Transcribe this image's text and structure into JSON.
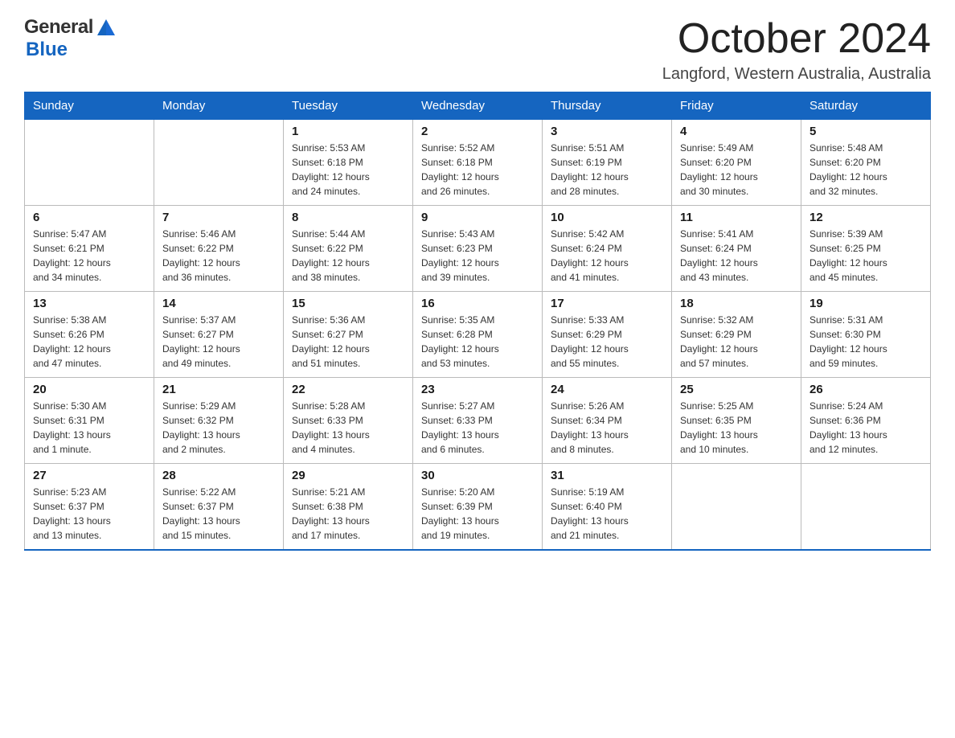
{
  "header": {
    "title": "October 2024",
    "subtitle": "Langford, Western Australia, Australia",
    "logo_general": "General",
    "logo_blue": "Blue"
  },
  "days_of_week": [
    "Sunday",
    "Monday",
    "Tuesday",
    "Wednesday",
    "Thursday",
    "Friday",
    "Saturday"
  ],
  "weeks": [
    [
      {
        "date": "",
        "info": ""
      },
      {
        "date": "",
        "info": ""
      },
      {
        "date": "1",
        "info": "Sunrise: 5:53 AM\nSunset: 6:18 PM\nDaylight: 12 hours\nand 24 minutes."
      },
      {
        "date": "2",
        "info": "Sunrise: 5:52 AM\nSunset: 6:18 PM\nDaylight: 12 hours\nand 26 minutes."
      },
      {
        "date": "3",
        "info": "Sunrise: 5:51 AM\nSunset: 6:19 PM\nDaylight: 12 hours\nand 28 minutes."
      },
      {
        "date": "4",
        "info": "Sunrise: 5:49 AM\nSunset: 6:20 PM\nDaylight: 12 hours\nand 30 minutes."
      },
      {
        "date": "5",
        "info": "Sunrise: 5:48 AM\nSunset: 6:20 PM\nDaylight: 12 hours\nand 32 minutes."
      }
    ],
    [
      {
        "date": "6",
        "info": "Sunrise: 5:47 AM\nSunset: 6:21 PM\nDaylight: 12 hours\nand 34 minutes."
      },
      {
        "date": "7",
        "info": "Sunrise: 5:46 AM\nSunset: 6:22 PM\nDaylight: 12 hours\nand 36 minutes."
      },
      {
        "date": "8",
        "info": "Sunrise: 5:44 AM\nSunset: 6:22 PM\nDaylight: 12 hours\nand 38 minutes."
      },
      {
        "date": "9",
        "info": "Sunrise: 5:43 AM\nSunset: 6:23 PM\nDaylight: 12 hours\nand 39 minutes."
      },
      {
        "date": "10",
        "info": "Sunrise: 5:42 AM\nSunset: 6:24 PM\nDaylight: 12 hours\nand 41 minutes."
      },
      {
        "date": "11",
        "info": "Sunrise: 5:41 AM\nSunset: 6:24 PM\nDaylight: 12 hours\nand 43 minutes."
      },
      {
        "date": "12",
        "info": "Sunrise: 5:39 AM\nSunset: 6:25 PM\nDaylight: 12 hours\nand 45 minutes."
      }
    ],
    [
      {
        "date": "13",
        "info": "Sunrise: 5:38 AM\nSunset: 6:26 PM\nDaylight: 12 hours\nand 47 minutes."
      },
      {
        "date": "14",
        "info": "Sunrise: 5:37 AM\nSunset: 6:27 PM\nDaylight: 12 hours\nand 49 minutes."
      },
      {
        "date": "15",
        "info": "Sunrise: 5:36 AM\nSunset: 6:27 PM\nDaylight: 12 hours\nand 51 minutes."
      },
      {
        "date": "16",
        "info": "Sunrise: 5:35 AM\nSunset: 6:28 PM\nDaylight: 12 hours\nand 53 minutes."
      },
      {
        "date": "17",
        "info": "Sunrise: 5:33 AM\nSunset: 6:29 PM\nDaylight: 12 hours\nand 55 minutes."
      },
      {
        "date": "18",
        "info": "Sunrise: 5:32 AM\nSunset: 6:29 PM\nDaylight: 12 hours\nand 57 minutes."
      },
      {
        "date": "19",
        "info": "Sunrise: 5:31 AM\nSunset: 6:30 PM\nDaylight: 12 hours\nand 59 minutes."
      }
    ],
    [
      {
        "date": "20",
        "info": "Sunrise: 5:30 AM\nSunset: 6:31 PM\nDaylight: 13 hours\nand 1 minute."
      },
      {
        "date": "21",
        "info": "Sunrise: 5:29 AM\nSunset: 6:32 PM\nDaylight: 13 hours\nand 2 minutes."
      },
      {
        "date": "22",
        "info": "Sunrise: 5:28 AM\nSunset: 6:33 PM\nDaylight: 13 hours\nand 4 minutes."
      },
      {
        "date": "23",
        "info": "Sunrise: 5:27 AM\nSunset: 6:33 PM\nDaylight: 13 hours\nand 6 minutes."
      },
      {
        "date": "24",
        "info": "Sunrise: 5:26 AM\nSunset: 6:34 PM\nDaylight: 13 hours\nand 8 minutes."
      },
      {
        "date": "25",
        "info": "Sunrise: 5:25 AM\nSunset: 6:35 PM\nDaylight: 13 hours\nand 10 minutes."
      },
      {
        "date": "26",
        "info": "Sunrise: 5:24 AM\nSunset: 6:36 PM\nDaylight: 13 hours\nand 12 minutes."
      }
    ],
    [
      {
        "date": "27",
        "info": "Sunrise: 5:23 AM\nSunset: 6:37 PM\nDaylight: 13 hours\nand 13 minutes."
      },
      {
        "date": "28",
        "info": "Sunrise: 5:22 AM\nSunset: 6:37 PM\nDaylight: 13 hours\nand 15 minutes."
      },
      {
        "date": "29",
        "info": "Sunrise: 5:21 AM\nSunset: 6:38 PM\nDaylight: 13 hours\nand 17 minutes."
      },
      {
        "date": "30",
        "info": "Sunrise: 5:20 AM\nSunset: 6:39 PM\nDaylight: 13 hours\nand 19 minutes."
      },
      {
        "date": "31",
        "info": "Sunrise: 5:19 AM\nSunset: 6:40 PM\nDaylight: 13 hours\nand 21 minutes."
      },
      {
        "date": "",
        "info": ""
      },
      {
        "date": "",
        "info": ""
      }
    ]
  ]
}
